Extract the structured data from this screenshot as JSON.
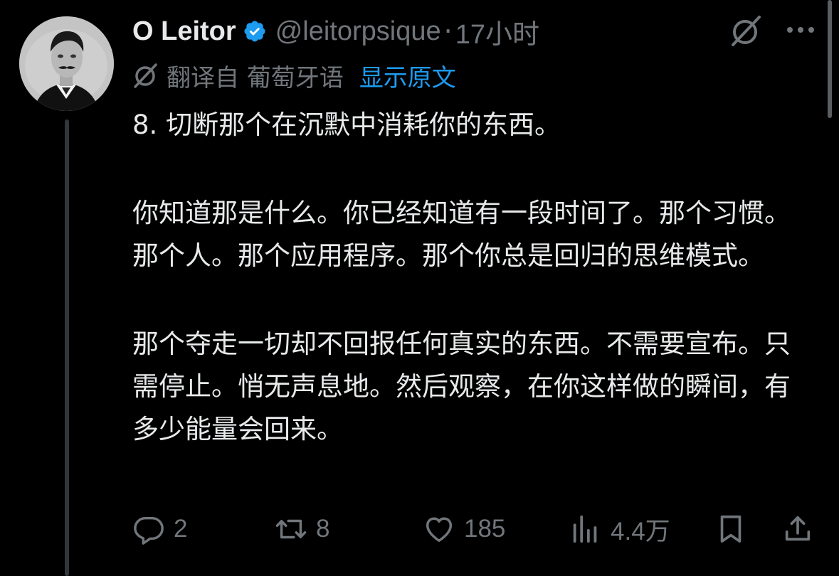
{
  "author": {
    "name": "O Leitor",
    "handle": "@leitorpsique",
    "separator": "·",
    "time": "17小时",
    "avatar_icon": "portrait-avatar",
    "verified_color": "#1d9bf0"
  },
  "translation": {
    "translated_from": "翻译自 葡萄牙语",
    "show_original": "显示原文",
    "icon": "translate-icon"
  },
  "tweet": {
    "paragraph1": "8. 切断那个在沉默中消耗你的东西。",
    "paragraph2": "你知道那是什么。你已经知道有一段时间了。那个习惯。那个人。那个应用程序。那个你总是回归的思维模式。",
    "paragraph3": "那个夺走一切却不回报任何真实的东西。不需要宣布。只需停止。悄无声息地。然后观察，在你这样做的瞬间，有多少能量会回来。"
  },
  "actions": {
    "replies": "2",
    "retweets": "8",
    "likes": "185",
    "views": "4.4万"
  },
  "colors": {
    "background": "#000000",
    "text": "#e7e9ea",
    "muted": "#71767b",
    "accent": "#1d9bf0"
  }
}
